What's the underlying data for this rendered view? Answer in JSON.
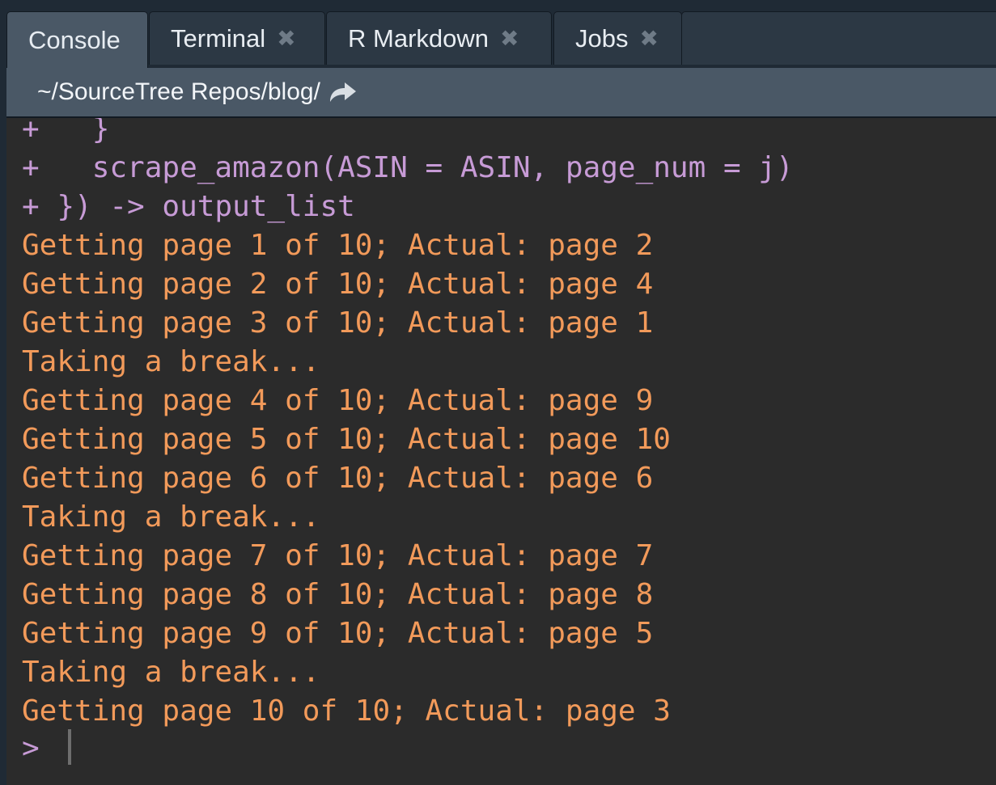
{
  "tabs": [
    {
      "label": "Console",
      "active": true,
      "closable": false
    },
    {
      "label": "Terminal",
      "active": false,
      "closable": true
    },
    {
      "label": "R Markdown",
      "active": false,
      "closable": true
    },
    {
      "label": "Jobs",
      "active": false,
      "closable": true
    }
  ],
  "close_glyph": "✖",
  "path": {
    "text": "~/SourceTree Repos/blog/",
    "icon": "go-to-directory-arrow-icon"
  },
  "console": {
    "lines": [
      {
        "kind": "cont",
        "text": "+   }"
      },
      {
        "kind": "cont",
        "text": "+   scrape_amazon(ASIN = ASIN, page_num = j)"
      },
      {
        "kind": "cont",
        "text": "+ }) -> output_list"
      },
      {
        "kind": "out",
        "text": "Getting page 1 of 10; Actual: page 2"
      },
      {
        "kind": "out",
        "text": "Getting page 2 of 10; Actual: page 4"
      },
      {
        "kind": "out",
        "text": "Getting page 3 of 10; Actual: page 1"
      },
      {
        "kind": "out",
        "text": "Taking a break..."
      },
      {
        "kind": "out",
        "text": "Getting page 4 of 10; Actual: page 9"
      },
      {
        "kind": "out",
        "text": "Getting page 5 of 10; Actual: page 10"
      },
      {
        "kind": "out",
        "text": "Getting page 6 of 10; Actual: page 6"
      },
      {
        "kind": "out",
        "text": "Taking a break..."
      },
      {
        "kind": "out",
        "text": "Getting page 7 of 10; Actual: page 7"
      },
      {
        "kind": "out",
        "text": "Getting page 8 of 10; Actual: page 8"
      },
      {
        "kind": "out",
        "text": "Getting page 9 of 10; Actual: page 5"
      },
      {
        "kind": "out",
        "text": "Taking a break..."
      },
      {
        "kind": "out",
        "text": "Getting page 10 of 10; Actual: page 3"
      }
    ],
    "prompt": ">"
  },
  "colors": {
    "continuation": "#c79bd6",
    "output": "#f29a5a",
    "background": "#2b2b2b",
    "tab_active": "#4a5866",
    "tab_inactive": "#2c3844"
  }
}
